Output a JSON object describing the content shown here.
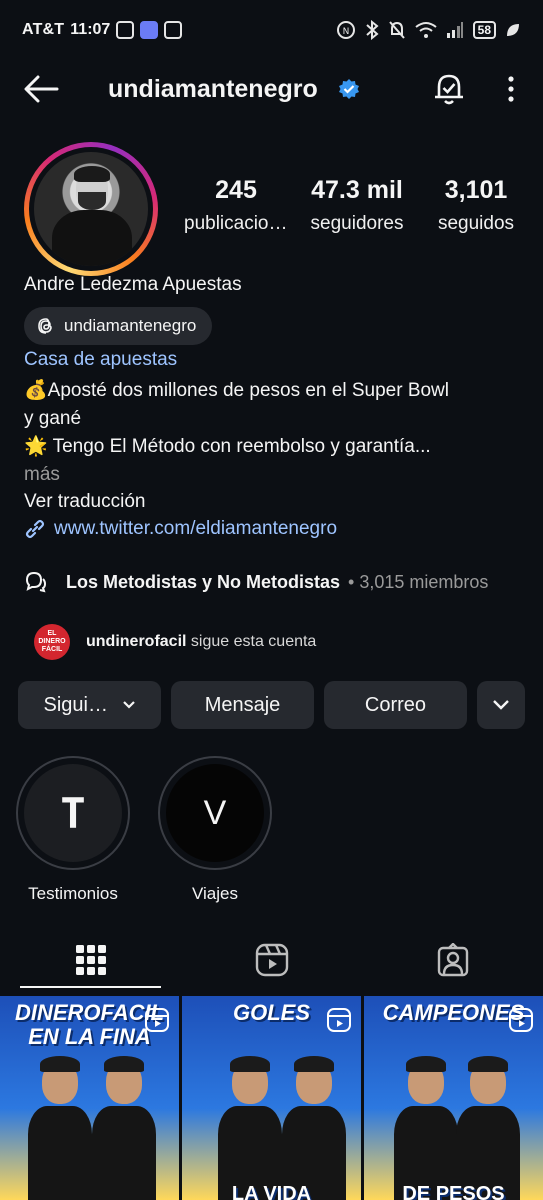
{
  "status_bar": {
    "carrier": "AT&T",
    "time": "11:07",
    "battery": "58"
  },
  "nav": {
    "title": "undiamantenegro"
  },
  "stats": [
    {
      "value": "245",
      "label": "publicaciones"
    },
    {
      "value": "47.3 mil",
      "label": "seguidores"
    },
    {
      "value": "3,101",
      "label": "seguidos"
    }
  ],
  "profile": {
    "name": "Andre Ledezma Apuestas",
    "threads_handle": "undiamantenegro",
    "category": "Casa de apuestas",
    "bio_line1": "💰Aposté dos millones de pesos en el Super Bowl",
    "bio_line2": "y gané",
    "bio_line3": "🌟 Tengo El Método con reembolso y garantía...",
    "more": "más",
    "translate": "Ver traducción",
    "link": "www.twitter.com/eldiamantenegro"
  },
  "channel": {
    "name": "Los Metodistas y No Metodistas",
    "meta": "• 3,015 miembros"
  },
  "followed_by": {
    "avatar_text": "EL DINERO FÁCIL",
    "username": "undinerofacil",
    "suffix": "sigue esta cuenta"
  },
  "actions": {
    "follow": "Siguiendo",
    "message": "Mensaje",
    "email": "Correo"
  },
  "highlights": [
    {
      "letter": "T",
      "label": "Testimonios"
    },
    {
      "letter": "V",
      "label": "Viajes"
    }
  ],
  "posts": [
    {
      "top_text": "DINEROFACIL",
      "sub_text": "EN LA FINA"
    },
    {
      "top_text": "GOLES",
      "sub_text": "LA VIDA"
    },
    {
      "top_text": "CAMPEONES",
      "sub_text": "DE PESOS"
    }
  ],
  "colors": {
    "background": "#0c0f14",
    "button": "#26292f",
    "link": "#9ec4ff",
    "verified": "#3897f0"
  }
}
